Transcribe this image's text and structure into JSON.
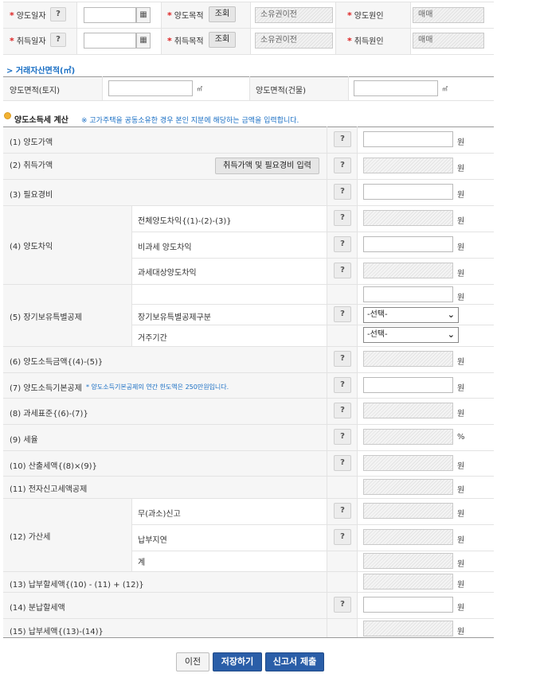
{
  "top": {
    "row1": {
      "date_label": "양도일자",
      "purpose_label": "양도목적",
      "lookup": "조회",
      "purpose_value": "소유권이전",
      "cause_label": "양도원인",
      "cause_value": "매매"
    },
    "row2": {
      "date_label": "취득일자",
      "purpose_label": "취득목적",
      "lookup": "조회",
      "purpose_value": "소유권이전",
      "cause_label": "취득원인",
      "cause_value": "매매"
    },
    "required_mark": "*",
    "help": "?",
    "calendar_icon": "calendar-icon"
  },
  "area": {
    "heading": "> 거래자산면적(㎡)",
    "land_label": "양도면적(토지)",
    "building_label": "양도면적(건물)",
    "unit": "㎡"
  },
  "tax": {
    "heading": "양도소득세 계산",
    "note": "※ 고가주택을 공동소유한 경우 본인 지분에 해당하는 금액을 입력합니다.",
    "won": "원",
    "percent": "%",
    "rows": {
      "r1": "(1) 양도가액",
      "r2": "(2) 취득가액",
      "r2_button": "취득가액 및 필요경비 입력",
      "r3": "(3) 필요경비",
      "r4": "(4) 양도차익",
      "r4_sub1": "전체양도차익{(1)-(2)-(3)}",
      "r4_sub2": "비과세 양도차익",
      "r4_sub3": "과세대상양도차익",
      "r5": "(5) 장기보유특별공제",
      "r5_sub1": "장기보유특별공제구분",
      "r5_sub2": "거주기간",
      "select_default": "-선택-",
      "r6": "(6) 양도소득금액{(4)-(5)}",
      "r7": "(7) 양도소득기본공제",
      "r7_note": "* 양도소득기본공제의 연간 한도액은 250만원입니다.",
      "r8": "(8) 과세표준{(6)-(7)}",
      "r9": "(9) 세율",
      "r10": "(10) 산출세액{(8)×(9)}",
      "r11": "(11) 전자신고세액공제",
      "r12": "(12) 가산세",
      "r12_sub1": "무(과소)신고",
      "r12_sub2": "납부지연",
      "r12_sub3": "계",
      "r13": "(13) 납부할세액{(10) - (11) + (12)}",
      "r14": "(14) 분납할세액",
      "r15": "(15) 납부세액{(13)-(14)}"
    }
  },
  "buttons": {
    "prev": "이전",
    "save": "저장하기",
    "submit": "신고서 제출"
  },
  "colors": {
    "primary": "#2a5ea8",
    "note_blue": "#1a6fc4",
    "required": "#d22222"
  }
}
